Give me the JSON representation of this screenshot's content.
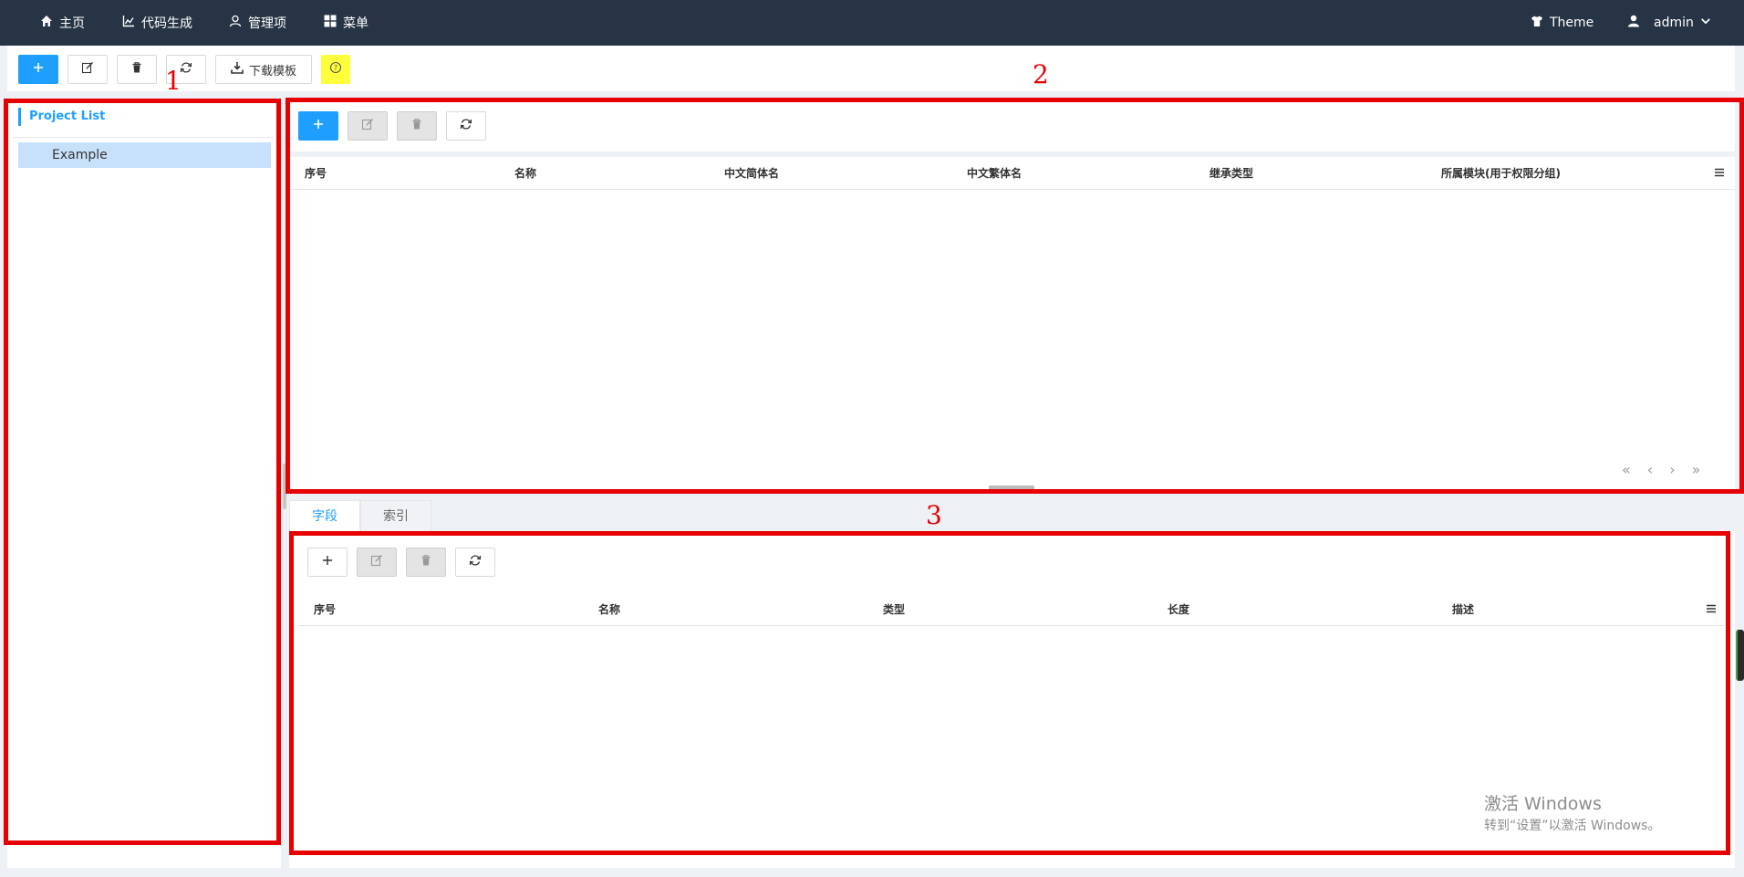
{
  "nav": {
    "home": "主页",
    "codegen": "代码生成",
    "manage": "管理项",
    "menu": "菜单",
    "theme": "Theme",
    "user": "admin"
  },
  "top_toolbar": {
    "download_template": "下载模板"
  },
  "sidebar": {
    "title": "Project List",
    "items": [
      {
        "label": "Example",
        "selected": true
      }
    ]
  },
  "main_table": {
    "columns": [
      "序号",
      "名称",
      "中文简体名",
      "中文繁体名",
      "继承类型",
      "所属模块(用于权限分组)"
    ],
    "rows": [],
    "pager": [
      "«",
      "‹",
      "›",
      "»"
    ]
  },
  "detail_tabs": [
    {
      "label": "字段",
      "active": true
    },
    {
      "label": "索引",
      "active": false
    }
  ],
  "detail_table": {
    "columns": [
      "序号",
      "名称",
      "类型",
      "长度",
      "描述"
    ],
    "rows": []
  },
  "annotations": [
    "1",
    "2",
    "3"
  ],
  "watermark": {
    "line1": "激活 Windows",
    "line2": "转到“设置”以激活 Windows。"
  },
  "colors": {
    "header_bg": "#263445",
    "primary": "#1e9fff",
    "annotation_red": "#e60000",
    "selected_row": "#c7e1fb",
    "help_yellow": "#ffff3c"
  },
  "icons": {
    "home": "home-icon",
    "codegen": "chart-icon",
    "manage": "user-outline-icon",
    "menu": "grid-icon",
    "theme": "shirt-icon",
    "user": "user-icon",
    "add": "plus-icon",
    "edit": "edit-icon",
    "delete": "trash-icon",
    "refresh": "refresh-icon",
    "download": "download-icon",
    "help": "question-icon",
    "column_menu": "hamburger-icon"
  }
}
